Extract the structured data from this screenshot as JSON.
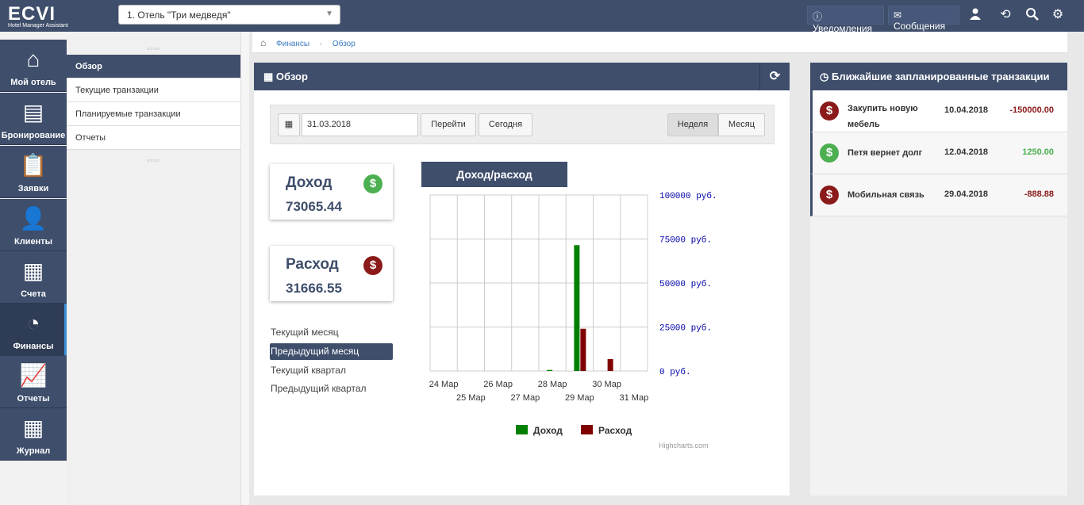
{
  "app": {
    "logo": "ECVI",
    "logo_sub": "Hotel Manager Assistant",
    "hotel_select": "1. Отель \"Три медведя\""
  },
  "topbar": {
    "notifications": "Уведомления",
    "messages": "Сообщения"
  },
  "sidebar": {
    "items": [
      {
        "label": "Мой отель",
        "icon": "home-icon"
      },
      {
        "label": "Бронирование",
        "icon": "inbox-icon"
      },
      {
        "label": "Заявки",
        "icon": "clipboard-icon"
      },
      {
        "label": "Клиенты",
        "icon": "user-icon"
      },
      {
        "label": "Счета",
        "icon": "document-icon"
      },
      {
        "label": "Финансы",
        "icon": "pie-chart-icon"
      },
      {
        "label": "Отчеты",
        "icon": "line-chart-icon"
      },
      {
        "label": "Журнал",
        "icon": "journal-icon"
      }
    ]
  },
  "submenu": {
    "items": [
      "Обзор",
      "Текущие транзакции",
      "Планируемые транзакции",
      "Отчеты"
    ]
  },
  "breadcrumb": [
    "Финансы",
    "Обзор"
  ],
  "overview": {
    "title": "Обзор",
    "date_value": "31.03.2018",
    "go_label": "Перейти",
    "today_label": "Сегодня",
    "week_label": "Неделя",
    "month_label": "Месяц",
    "income_title": "Доход",
    "income_value": "73065.44",
    "expense_title": "Расход",
    "expense_value": "31666.55",
    "periods": [
      "Текущий месяц",
      "Предыдущий месяц",
      "Текущий квартал",
      "Предыдущий квартал"
    ],
    "chart_title": "Доход/расход",
    "credits": "Highcharts.com"
  },
  "chart_data": {
    "type": "bar",
    "categories": [
      "24 Мар",
      "25 Мар",
      "26 Мар",
      "27 Мар",
      "28 Мар",
      "29 Мар",
      "30 Мар",
      "31 Мар"
    ],
    "series": [
      {
        "name": "Доход",
        "color": "#008000",
        "values": [
          0,
          0,
          0,
          0,
          600,
          71500,
          0,
          0
        ]
      },
      {
        "name": "Расход",
        "color": "#800000",
        "values": [
          0,
          0,
          0,
          0,
          0,
          24000,
          6800,
          0
        ]
      }
    ],
    "y_tick_labels": [
      "100000 руб.",
      "75000 руб.",
      "50000 руб.",
      "25000 руб.",
      "0 руб."
    ],
    "ylim": [
      0,
      100000
    ],
    "legend_position": "bottom",
    "grid": true
  },
  "planned": {
    "title": "Ближайшие запланированные транзакции",
    "items": [
      {
        "name": "Закупить новую мебель",
        "date": "10.04.2018",
        "amount": "-150000.00",
        "type": "expense"
      },
      {
        "name": "Петя вернет долг",
        "date": "12.04.2018",
        "amount": "1250.00",
        "type": "income"
      },
      {
        "name": "Мобильная связь",
        "date": "29.04.2018",
        "amount": "-888.88",
        "type": "expense"
      }
    ]
  },
  "colors": {
    "header": "#3e4e6b",
    "income": "#008000",
    "expense": "#800000",
    "income_icon": "#4caf50",
    "expense_icon": "#8b1a1a"
  }
}
